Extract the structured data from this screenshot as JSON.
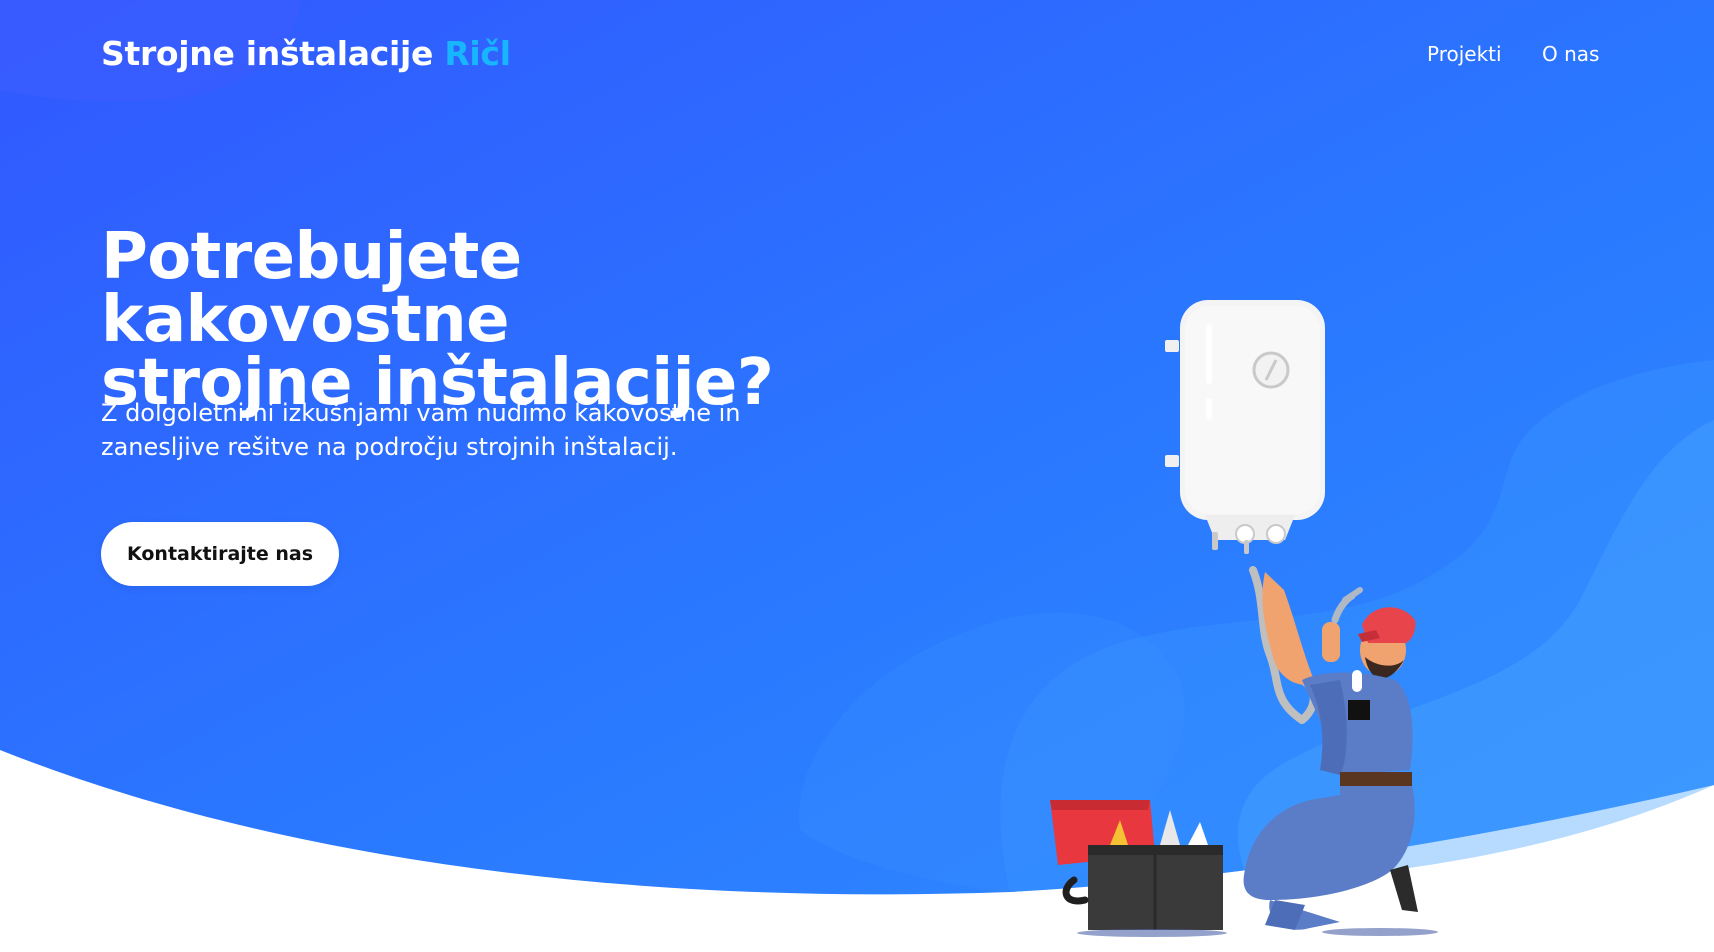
{
  "header": {
    "logo_main": "Strojne inštalacije",
    "logo_accent": "Ričl",
    "nav": {
      "projects": "Projekti",
      "about": "O nas"
    }
  },
  "hero": {
    "title_line1": "Potrebujete kakovostne",
    "title_line2": "strojne inštalacije?",
    "subtitle_line1": "Z dolgoletnimi izkušnjami vam nudimo kakovostne in",
    "subtitle_line2": "zanesljive rešitve na področju strojnih inštalacij.",
    "cta_label": "Kontaktirajte nas"
  },
  "colors": {
    "hero_gradient_start": "#3158ff",
    "hero_gradient_end": "#2f8cff",
    "logo_accent": "#18b6ff",
    "text": "#ffffff",
    "button_bg": "#ffffff",
    "button_text": "#111111"
  },
  "icons": {
    "illustration": "plumber-water-heater-illustration"
  }
}
